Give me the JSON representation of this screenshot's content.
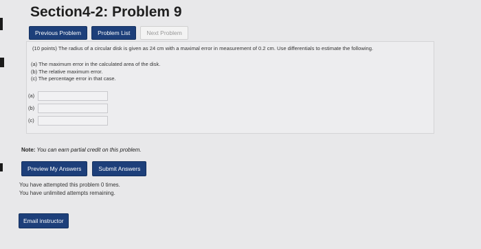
{
  "page": {
    "title": "Section4-2: Problem 9"
  },
  "nav": {
    "previous_label": "Previous Problem",
    "list_label": "Problem List",
    "next_label": "Next Problem"
  },
  "problem": {
    "statement": "(10 points) The radius of a circular disk is given as 24 cm with a maximal error in measurement of 0.2 cm. Use differentials to estimate the following.",
    "parts": [
      "(a) The maximum error in the calculated area of the disk.",
      "(b) The relative maximum error.",
      "(c) The percentage error in that case."
    ],
    "answers": [
      {
        "label": "(a)",
        "value": ""
      },
      {
        "label": "(b)",
        "value": ""
      },
      {
        "label": "(c)",
        "value": ""
      }
    ]
  },
  "note": {
    "prefix": "Note:",
    "text": "You can earn partial credit on this problem."
  },
  "actions": {
    "preview_label": "Preview My Answers",
    "submit_label": "Submit Answers"
  },
  "attempts": {
    "line1": "You have attempted this problem 0 times.",
    "line2": "You have unlimited attempts remaining."
  },
  "email": {
    "label": "Email instructor"
  }
}
